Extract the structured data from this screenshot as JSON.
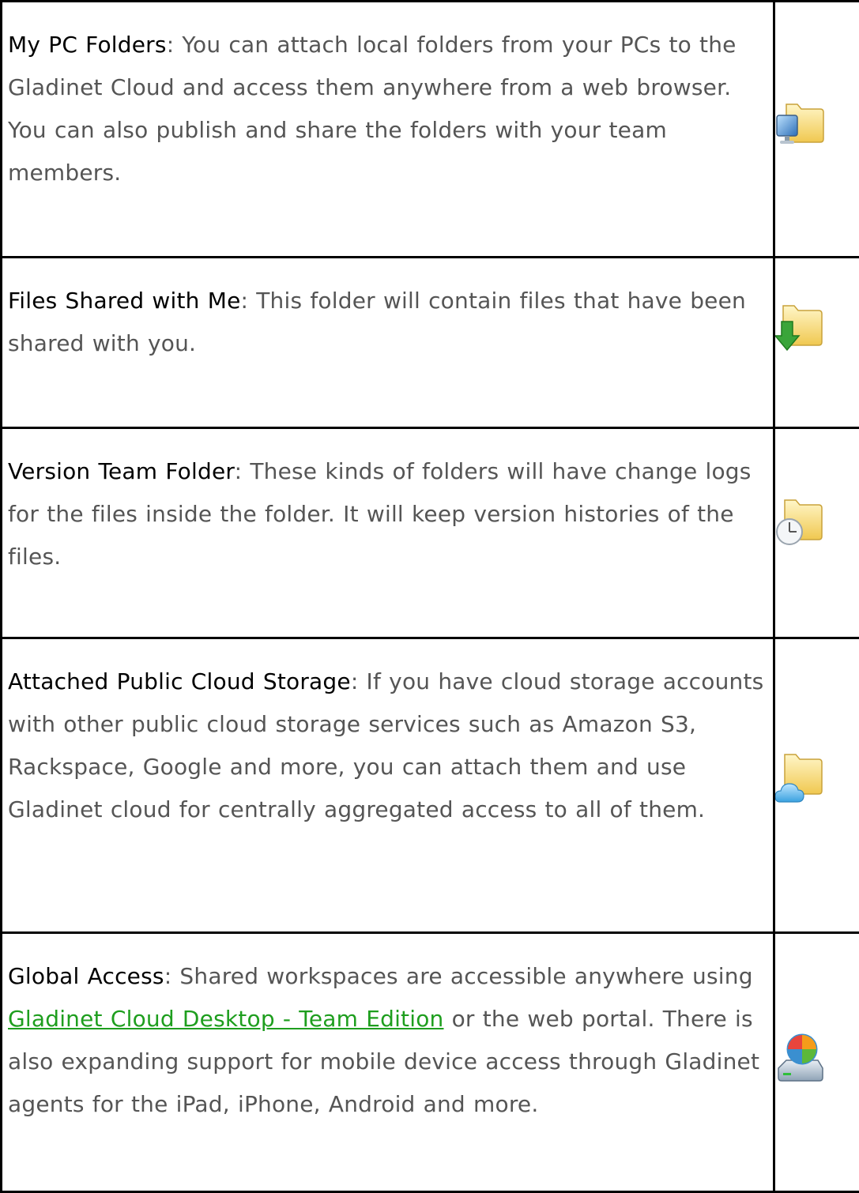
{
  "rows": [
    {
      "term": "My PC Folders",
      "description": ": You can attach local folders from your PCs to the Gladinet Cloud and access them anywhere from a web browser. You can also publish and share the folders with your team members.",
      "icon": "folder-with-computer-icon"
    },
    {
      "term": "Files Shared with Me",
      "description": ": This folder will contain files that have been shared with you.",
      "icon": "folder-with-download-arrow-icon"
    },
    {
      "term": "Version Team Folder",
      "description": ": These kinds of folders will have change logs for the files inside the folder. It will keep version histories of the files.",
      "icon": "folder-with-clock-icon"
    },
    {
      "term": "Attached Public Cloud Storage",
      "description": ": If you have cloud storage accounts with other public cloud storage services such as Amazon S3, Rackspace, Google and more, you can attach them and use Gladinet cloud for centrally aggregated access to all of them.",
      "icon": "folder-with-cloud-icon"
    },
    {
      "term": "Global Access",
      "description_before": ": Shared workspaces are accessible anywhere using ",
      "link_text": "Gladinet Cloud Desktop - Team Edition",
      "description_after": " or the web portal. There is also expanding support for mobile device access through Gladinet agents for the iPad, iPhone, Android and more.",
      "icon": "drive-with-globe-icon"
    }
  ],
  "colors": {
    "term": "#000000",
    "body_text": "#555555",
    "link": "#1e9e1e",
    "border": "#000000"
  }
}
